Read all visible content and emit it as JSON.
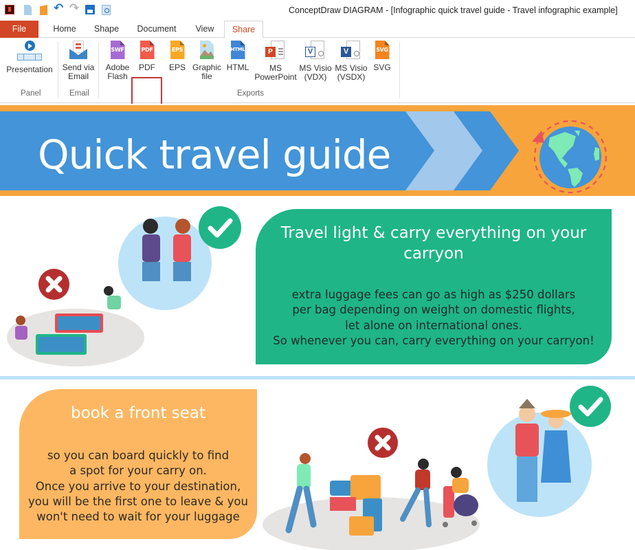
{
  "window": {
    "title": "ConceptDraw DIAGRAM - [Infographic quick travel guide - Travel infographic example]"
  },
  "quick_access": [
    {
      "name": "app-logo-icon"
    },
    {
      "name": "new-document-icon"
    },
    {
      "name": "open-document-icon"
    },
    {
      "name": "undo-icon",
      "glyph": "↶"
    },
    {
      "name": "redo-icon",
      "glyph": "↷"
    },
    {
      "name": "save-icon"
    },
    {
      "name": "print-preview-icon"
    }
  ],
  "tabs": [
    {
      "label": "File",
      "active": false
    },
    {
      "label": "Home",
      "active": false
    },
    {
      "label": "Shape",
      "active": false
    },
    {
      "label": "Document",
      "active": false
    },
    {
      "label": "View",
      "active": false
    },
    {
      "label": "Share",
      "active": true
    }
  ],
  "ribbon": {
    "groups": [
      {
        "label": "Panel",
        "buttons": [
          {
            "label": "Presentation",
            "icon": "presentation-icon"
          }
        ]
      },
      {
        "label": "Email",
        "buttons": [
          {
            "label": "Send via\nEmail",
            "icon": "email-icon"
          }
        ]
      },
      {
        "label": "Exports",
        "buttons": [
          {
            "label": "Adobe\nFlash",
            "icon": "swf-file-icon",
            "badge": "SWF",
            "color": "#a66bd3"
          },
          {
            "label": "PDF",
            "icon": "pdf-file-icon",
            "badge": "PDF",
            "color": "#f25a4a",
            "highlighted": true
          },
          {
            "label": "EPS",
            "icon": "eps-file-icon",
            "badge": "EPS",
            "color": "#f9a825"
          },
          {
            "label": "Graphic\nfile",
            "icon": "image-file-icon"
          },
          {
            "label": "HTML",
            "icon": "html-file-icon",
            "badge": "HTML",
            "color": "#3f86d8"
          },
          {
            "label": "MS\nPowerPoint",
            "icon": "powerpoint-icon",
            "badge": "P"
          },
          {
            "label": "MS Visio\n(VDX)",
            "icon": "visio-vdx-icon",
            "badge": "V"
          },
          {
            "label": "MS Visio\n(VSDX)",
            "icon": "visio-vsdx-icon",
            "badge": "V"
          },
          {
            "label": "SVG",
            "icon": "svg-file-icon",
            "badge": "SVG",
            "color": "#f5841f"
          }
        ]
      }
    ]
  },
  "infographic": {
    "title": "Quick travel guide",
    "colors": {
      "banner_orange": "#f7a43c",
      "banner_blue": "#4394d8",
      "chevron_light": "#a2c8ec",
      "green": "#1fb587",
      "orange_card": "#fdb762",
      "red_badge": "#b52f2f",
      "light_blue_circle": "#bde3f8"
    },
    "tips": [
      {
        "heading": "Travel light & carry everything on your carryon",
        "body": "extra luggage fees can go as high as $250 dollars\nper bag depending on weight on domestic flights,\nlet alone on international ones.\nSo whenever you can, carry everything on your carryon!"
      },
      {
        "heading": "book a front seat",
        "body": "so you can board quickly to find\na spot for your carry on.\nOnce you arrive to your destination,\nyou will be the first one to leave & you\n won't need to wait for your luggage"
      }
    ]
  }
}
